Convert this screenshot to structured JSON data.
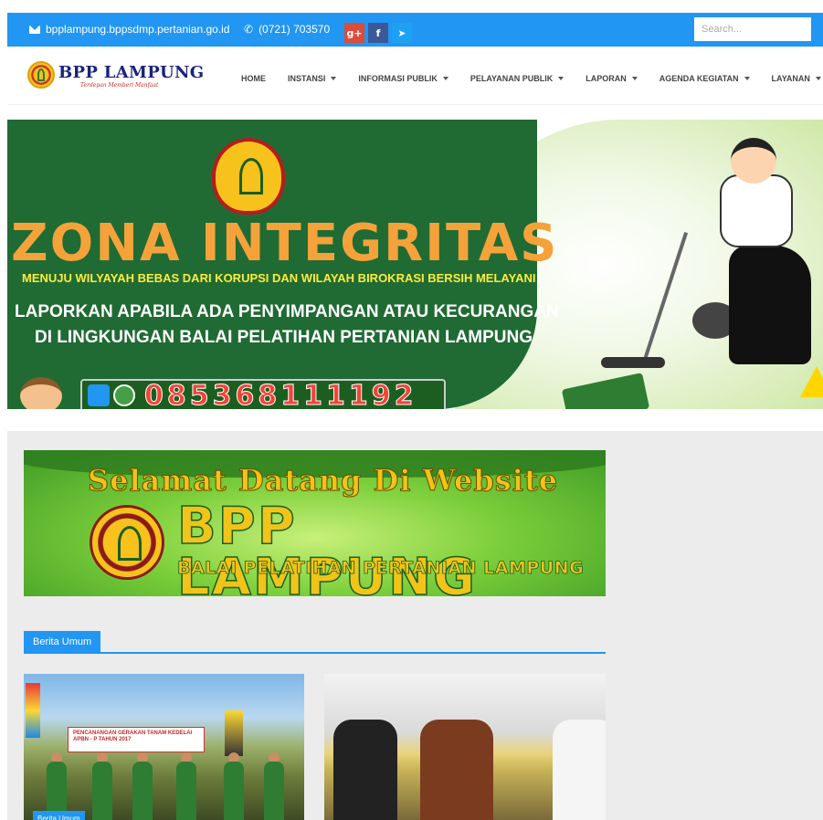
{
  "topbar": {
    "email": "bpplampung.bppsdmp.pertanian.go.id",
    "phone": "(0721) 703570",
    "search_placeholder": "Search...",
    "social": [
      {
        "name": "google-plus",
        "glyph": "g+",
        "color": "#dd4b39"
      },
      {
        "name": "facebook",
        "glyph": "f",
        "color": "#3b5998"
      },
      {
        "name": "twitter",
        "glyph": "→",
        "color": "#1da1f2"
      }
    ]
  },
  "header": {
    "brand": "BPP LAMPUNG",
    "tagline": "Terdepan Memberi Manfaat",
    "nav": [
      {
        "label": "HOME",
        "dropdown": false
      },
      {
        "label": "INSTANSI",
        "dropdown": true
      },
      {
        "label": "INFORMASI PUBLIK",
        "dropdown": true
      },
      {
        "label": "PELAYANAN PUBLIK",
        "dropdown": true
      },
      {
        "label": "LAPORAN",
        "dropdown": true
      },
      {
        "label": "AGENDA KEGIATAN",
        "dropdown": true
      },
      {
        "label": "LAYANAN",
        "dropdown": true
      }
    ]
  },
  "hero": {
    "title": "ZONA INTEGRITAS",
    "subtitle": "MENUJU WILYAYAH BEBAS DARI KORUPSI DAN WILAYAH BIROKRASI BERSIH MELAYANI",
    "line1": "LAPORKAN APABILA ADA PENYIMPANGAN ATAU KECURANGAN",
    "line2": "DI LINGKUNGAN BALAI PELATIHAN PERTANIAN LAMPUNG",
    "phone": "085368111192"
  },
  "welcome": {
    "line1": "Selamat Datang Di Website",
    "line2": "BPP LAMPUNG",
    "line3": "BALAI PELATIHAN PERTANIAN LAMPUNG"
  },
  "news": {
    "section_title": "Berita Umum",
    "card1_badge": "Berita Umum",
    "card1_banner": "PENCANANGAN GERAKAN TANAM KEDELAI APBN - P TAHUN 2017"
  },
  "colors": {
    "primary": "#2196f3",
    "hero_green": "#1f6b33",
    "zona_orange": "#f5a23b",
    "gold": "#f0c419"
  }
}
